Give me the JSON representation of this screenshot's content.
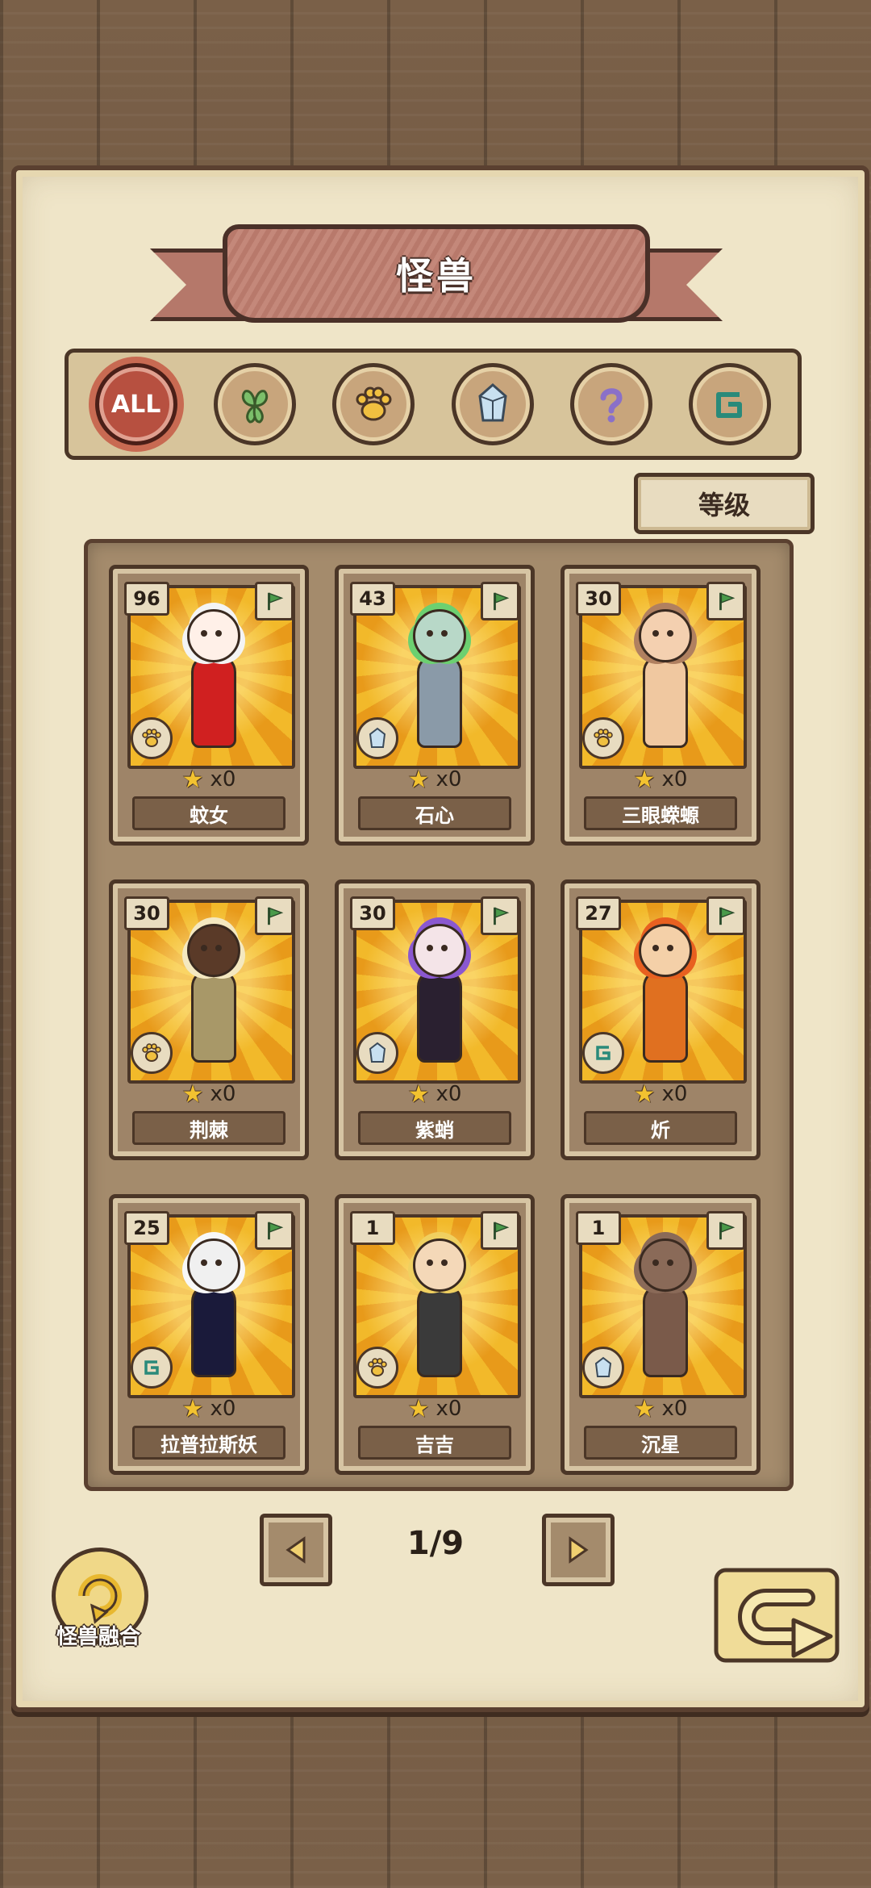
{
  "header": {
    "title": "怪兽"
  },
  "filters": [
    {
      "id": "all",
      "label": "ALL",
      "active": true
    },
    {
      "id": "plant",
      "icon": "leaf-icon",
      "active": false
    },
    {
      "id": "beast",
      "icon": "paw-icon",
      "active": false
    },
    {
      "id": "mineral",
      "icon": "crystal-icon",
      "active": false
    },
    {
      "id": "mystery",
      "icon": "question-icon",
      "active": false
    },
    {
      "id": "spirit",
      "icon": "spiral-icon",
      "active": false
    }
  ],
  "sort": {
    "label": "等级"
  },
  "cards": [
    {
      "level": "96",
      "name": "蚊女",
      "count": "x0",
      "type": "paw",
      "hair": "#f4f4f4",
      "outfit": "#d02020",
      "skin": "#fff0e8"
    },
    {
      "level": "43",
      "name": "石心",
      "count": "x0",
      "type": "crystal",
      "hair": "#6cd070",
      "outfit": "#8a9aa8",
      "skin": "#b8d8c8"
    },
    {
      "level": "30",
      "name": "三眼蝾螈",
      "count": "x0",
      "type": "paw",
      "hair": "#b08060",
      "outfit": "#f0c8a0",
      "skin": "#f4d0b0"
    },
    {
      "level": "30",
      "name": "荆棘",
      "count": "x0",
      "type": "paw",
      "hair": "#f4e8c0",
      "outfit": "#a89868",
      "skin": "#5a3a28"
    },
    {
      "level": "30",
      "name": "紫蛸",
      "count": "x0",
      "type": "crystal",
      "hair": "#8a58d0",
      "outfit": "#2a2030",
      "skin": "#f4e4e8"
    },
    {
      "level": "27",
      "name": "炘",
      "count": "x0",
      "type": "spirit",
      "hair": "#e86020",
      "outfit": "#e07020",
      "skin": "#f4d0a8"
    },
    {
      "level": "25",
      "name": "拉普拉斯妖",
      "count": "x0",
      "type": "spirit",
      "hair": "#f8f8f8",
      "outfit": "#1a1a3a",
      "skin": "#f0f0f0"
    },
    {
      "level": "1",
      "name": "吉吉",
      "count": "x0",
      "type": "paw",
      "hair": "#f0d060",
      "outfit": "#3a3a3a",
      "skin": "#f4d8b8"
    },
    {
      "level": "1",
      "name": "沉星",
      "count": "x0",
      "type": "crystal",
      "hair": "#8a6a58",
      "outfit": "#7a5a4a",
      "skin": "#8a6a58"
    }
  ],
  "pager": {
    "current": "1/9"
  },
  "fusion": {
    "label": "怪兽融合"
  },
  "colors": {
    "accent": "#b75040",
    "card_bg": "#f2b92a",
    "wood": "#6b5440",
    "parchment": "#efe5c8"
  }
}
